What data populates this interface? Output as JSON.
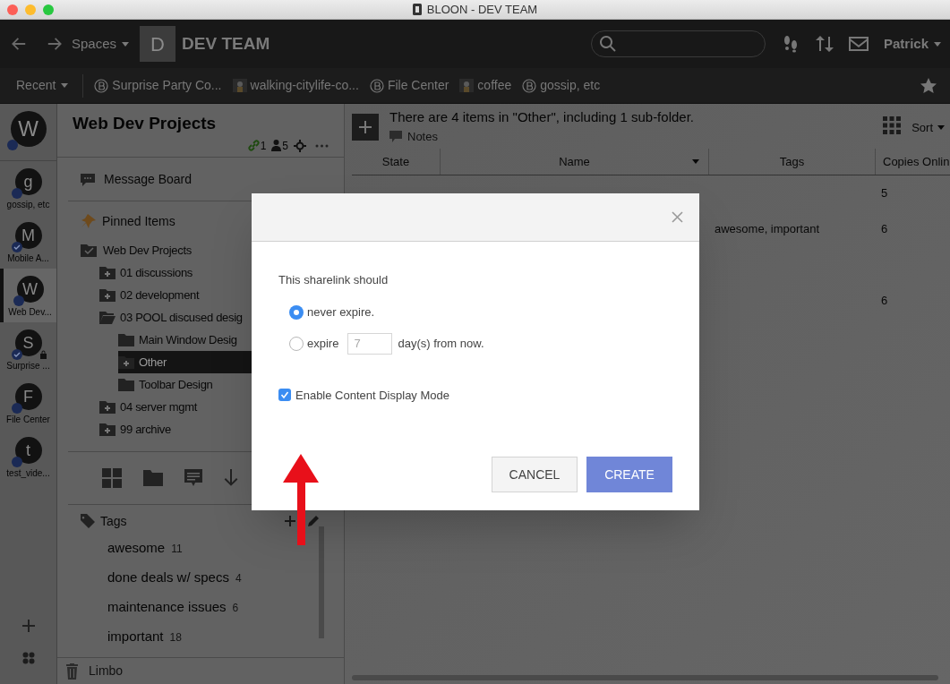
{
  "window": {
    "title": "BLOON - DEV TEAM"
  },
  "toolbar": {
    "spaces_label": "Spaces",
    "space_initial": "D",
    "space_name": "DEV TEAM",
    "user": "Patrick"
  },
  "recent_bar": {
    "label": "Recent",
    "items": [
      {
        "kind": "space",
        "label": "Surprise Party Co..."
      },
      {
        "kind": "thumb",
        "label": "walking-citylife-co..."
      },
      {
        "kind": "space",
        "label": "File Center"
      },
      {
        "kind": "thumb",
        "label": "coffee"
      },
      {
        "kind": "space",
        "label": "gossip, etc"
      }
    ]
  },
  "rail": {
    "items": [
      {
        "initial": "W",
        "verified": false,
        "selected": false,
        "locked": false
      },
      {
        "initial": "g",
        "label": "gossip, etc",
        "verified": false,
        "selected": false,
        "locked": false
      },
      {
        "initial": "M",
        "label": "Mobile A...",
        "verified": true,
        "selected": false,
        "locked": false
      },
      {
        "initial": "W",
        "label": "Web Dev...",
        "verified": false,
        "selected": true,
        "locked": false
      },
      {
        "initial": "S",
        "label": "Surprise ...",
        "verified": true,
        "selected": false,
        "locked": true
      },
      {
        "initial": "F",
        "label": "File Center",
        "verified": false,
        "selected": false,
        "locked": false
      },
      {
        "initial": "t",
        "label": "test_vide...",
        "verified": false,
        "selected": false,
        "locked": false
      }
    ]
  },
  "sidebar": {
    "title": "Web Dev Projects",
    "links": "1",
    "members": "5",
    "items": [
      {
        "kind": "board",
        "label": "Message Board"
      },
      {
        "kind": "pin",
        "label": "Pinned Items"
      }
    ],
    "tree": [
      {
        "kind": "root",
        "label": "Web Dev Projects",
        "selected": false,
        "children": [
          {
            "kind": "shared",
            "label": "01 discussions",
            "selected": false
          },
          {
            "kind": "shared",
            "label": "02 development",
            "selected": false
          },
          {
            "kind": "open",
            "label": "03 POOL discused desig",
            "selected": false,
            "children": [
              {
                "kind": "folder",
                "label": "Main Window Desig",
                "selected": false
              },
              {
                "kind": "shared",
                "label": "Other",
                "selected": true
              },
              {
                "kind": "folder",
                "label": "Toolbar Design",
                "selected": false
              }
            ]
          },
          {
            "kind": "shared",
            "label": "04 server mgmt",
            "selected": false
          },
          {
            "kind": "shared",
            "label": "99 archive",
            "selected": false
          }
        ]
      }
    ],
    "tags_label": "Tags",
    "tags": [
      {
        "name": "awesome",
        "count": "11"
      },
      {
        "name": "done deals w/ specs",
        "count": "4"
      },
      {
        "name": "maintenance issues",
        "count": "6"
      },
      {
        "name": "important",
        "count": "18"
      }
    ],
    "footer": "Limbo"
  },
  "main": {
    "summary": "There are 4 items in \"Other\", including 1 sub-folder.",
    "notes_label": "Notes",
    "sort_label": "Sort",
    "columns": [
      "State",
      "Name",
      "Tags",
      "Copies Onlin"
    ],
    "rows": [
      {
        "copies": "5"
      },
      {
        "tags": "awesome, important",
        "copies": "6"
      },
      {
        "copies": "6"
      }
    ]
  },
  "dialog": {
    "prompt": "This sharelink should",
    "options": [
      {
        "label": "never expire.",
        "selected": true
      },
      {
        "label": "expire",
        "selected": false,
        "days_placeholder": "7",
        "suffix": "day(s) from now."
      }
    ],
    "content_display": {
      "label": "Enable Content Display Mode",
      "checked": true
    },
    "buttons": [
      {
        "kind": "secondary",
        "label": "CANCEL"
      },
      {
        "kind": "primary",
        "label": "CREATE"
      }
    ]
  }
}
